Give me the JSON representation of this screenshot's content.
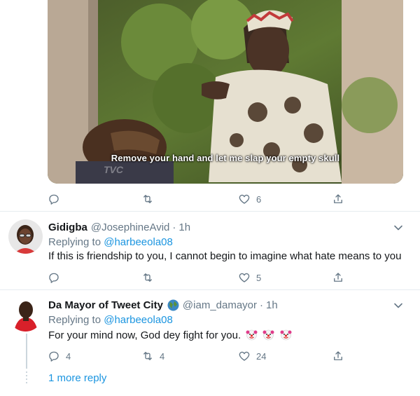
{
  "tweet_media": {
    "subtitle": "Remove your hand and let me slap your empty skull",
    "watermark": "TVC"
  },
  "tweet1_actions": {
    "reply_count": "",
    "retweet_count": "",
    "like_count": "6"
  },
  "reply1": {
    "name": "Gidigba",
    "handle": "@JosephineAvid",
    "time": "1h",
    "replying_prefix": "Replying to",
    "replying_to": "@harbeeola08",
    "text": "If this is friendship to you, I cannot begin to imagine what hate means to you",
    "reply_count": "",
    "retweet_count": "",
    "like_count": "5"
  },
  "reply2": {
    "name": "Da Mayor of Tweet City",
    "handle": "@iam_damayor",
    "time": "1h",
    "replying_prefix": "Replying to",
    "replying_to": "@harbeeola08",
    "text": "For your mind now, God dey fight for you.",
    "emoji_name": "clown-face-icon",
    "reply_count": "4",
    "retweet_count": "4",
    "like_count": "24"
  },
  "more_replies": "1 more reply",
  "colors": {
    "accent": "#1b95e0",
    "muted": "#657786",
    "divider": "#e6ecf0"
  }
}
